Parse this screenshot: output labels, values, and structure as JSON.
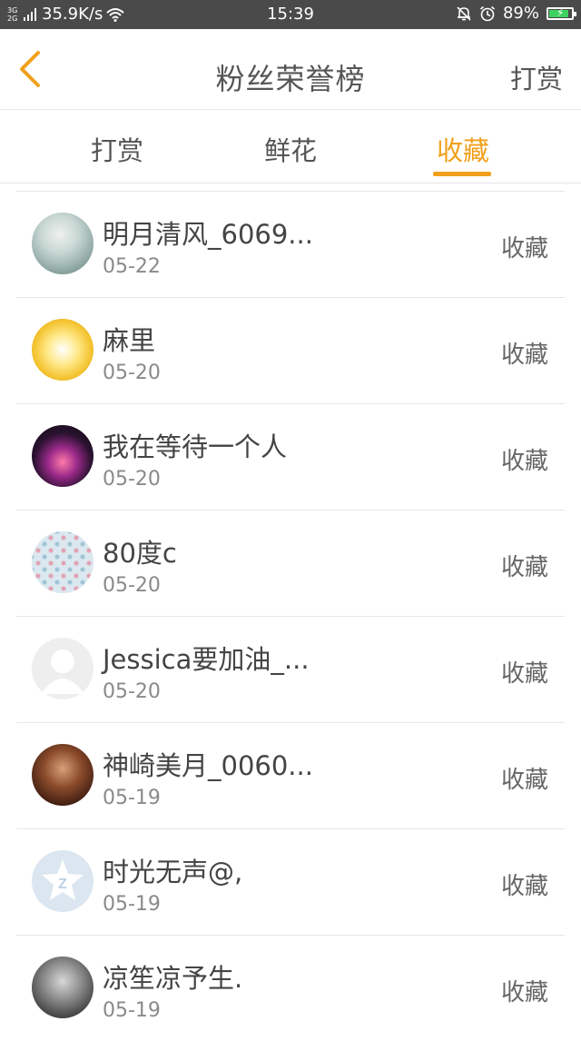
{
  "status_bar": {
    "network": "3G\n2G",
    "speed": "35.9K/s",
    "time": "15:39",
    "battery": "89%",
    "battery_level": 0.89,
    "icons": [
      "signal-icon",
      "wifi-icon",
      "mute-bell-icon",
      "alarm-icon",
      "battery-icon"
    ]
  },
  "header": {
    "title": "粉丝荣誉榜",
    "right_action": "打赏",
    "back_icon": "chevron-left-icon"
  },
  "tabs": [
    {
      "label": "打赏",
      "active": false
    },
    {
      "label": "鲜花",
      "active": false
    },
    {
      "label": "收藏",
      "active": true
    }
  ],
  "colors": {
    "accent": "#f0a01a",
    "status_bar": "#4a4a4a",
    "battery_fill": "#3ed35f"
  },
  "fans": [
    {
      "name": "明月清风_6069...",
      "date": "05-22",
      "action": "收藏"
    },
    {
      "name": "麻里",
      "date": "05-20",
      "action": "收藏"
    },
    {
      "name": "我在等待一个人",
      "date": "05-20",
      "action": "收藏"
    },
    {
      "name": "80度c",
      "date": "05-20",
      "action": "收藏"
    },
    {
      "name": "Jessica要加油_...",
      "date": "05-20",
      "action": "收藏"
    },
    {
      "name": "神崎美月_0060...",
      "date": "05-19",
      "action": "收藏"
    },
    {
      "name": "时光无声@,",
      "date": "05-19",
      "action": "收藏"
    },
    {
      "name": "凉笙凉予生.",
      "date": "05-19",
      "action": "收藏"
    }
  ]
}
